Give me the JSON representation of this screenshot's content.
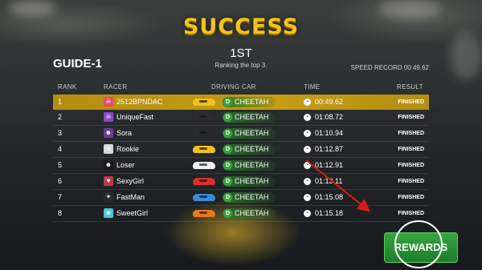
{
  "header": {
    "title": "SUCCESS",
    "place": "1ST",
    "subtitle": "Ranking the top 3.",
    "stage": "GUIDE-1",
    "speed_record": "SPEED RECORD 00:49.62"
  },
  "columns": {
    "rank": "RANK",
    "racer": "RACER",
    "car": "DRIVING CAR",
    "time": "TIME",
    "result": "RESULT"
  },
  "rows": [
    {
      "rank": "1",
      "name": "2512BPNDAC",
      "car": "CHEETAH",
      "time": "00:49.62",
      "result": "FINISHED",
      "car_color": "#f3c21a",
      "avatar_color": "#e84a6a",
      "avatar_icon": "skull-icon"
    },
    {
      "rank": "2",
      "name": "UniqueFast",
      "car": "CHEETAH",
      "time": "01:08.72",
      "result": "FINISHED",
      "car_color": "#2d2d2d",
      "avatar_color": "#8a4ad0",
      "avatar_icon": "skull-icon"
    },
    {
      "rank": "3",
      "name": "Sora",
      "car": "CHEETAH",
      "time": "01:10.94",
      "result": "FINISHED",
      "car_color": "#2a2a2a",
      "avatar_color": "#6a3a9a",
      "avatar_icon": "cat-icon"
    },
    {
      "rank": "4",
      "name": "Rookie",
      "car": "CHEETAH",
      "time": "01:12.87",
      "result": "FINISHED",
      "car_color": "#f3c21a",
      "avatar_color": "#d8d8d8",
      "avatar_icon": "skull-icon"
    },
    {
      "rank": "5",
      "name": "Loser",
      "car": "CHEETAH",
      "time": "01:12.91",
      "result": "FINISHED",
      "car_color": "#f0f0f0",
      "avatar_color": "#1a1a1a",
      "avatar_icon": "cat-icon"
    },
    {
      "rank": "6",
      "name": "SexyGirl",
      "car": "CHEETAH",
      "time": "01:13.11",
      "result": "FINISHED",
      "car_color": "#d83030",
      "avatar_color": "#c23a4a",
      "avatar_icon": "lips-icon"
    },
    {
      "rank": "7",
      "name": "FastMan",
      "car": "CHEETAH",
      "time": "01:15.08",
      "result": "FINISHED",
      "car_color": "#3a8ad8",
      "avatar_color": "#2a2a2a",
      "avatar_icon": "runner-icon"
    },
    {
      "rank": "8",
      "name": "SweetGirl",
      "car": "CHEETAH",
      "time": "01:15.18",
      "result": "FINISHED",
      "car_color": "#e87a1a",
      "avatar_color": "#4ac8d8",
      "avatar_icon": "cat-icon"
    }
  ],
  "rewards_button": "REWARDS",
  "colors": {
    "title": "#f5c21b",
    "highlight_row": "#c49c16",
    "button": "#2b9436",
    "annotation_arrow": "#e01818"
  }
}
